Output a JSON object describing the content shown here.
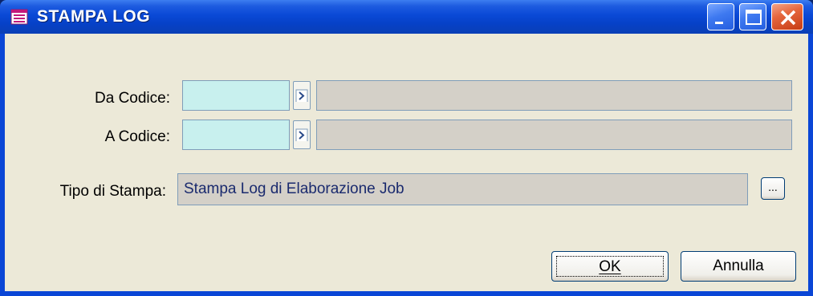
{
  "window": {
    "title": "STAMPA LOG",
    "icon": "print-log-icon"
  },
  "form": {
    "da_codice_label": "Da Codice:",
    "da_codice_value": "",
    "da_codice_desc": "",
    "a_codice_label": "A Codice:",
    "a_codice_value": "",
    "a_codice_desc": "",
    "tipo_label": "Tipo di Stampa:",
    "tipo_value": "Stampa Log di Elaborazione Job",
    "tipo_browse_label": "..."
  },
  "buttons": {
    "ok_label": "OK",
    "cancel_label": "Annulla"
  },
  "colors": {
    "code_field": "#c8f0ee",
    "readonly_field": "#d4d0c8",
    "titlebar": "#0a49d6",
    "value_text": "#1a2a6e"
  }
}
